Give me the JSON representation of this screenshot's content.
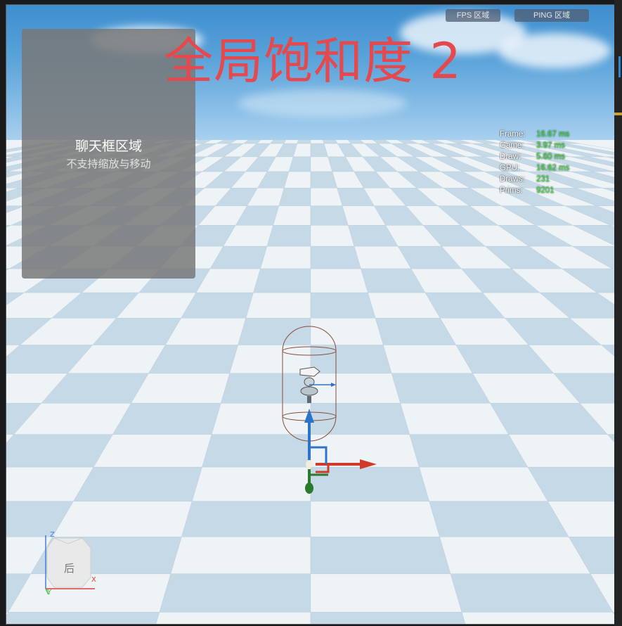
{
  "hud": {
    "fps_button": "FPS 区域",
    "ping_button": "PING 区域"
  },
  "title_overlay": "全局饱和度 2",
  "chat_panel": {
    "title": "聊天框区域",
    "subtitle": "不支持缩放与移动"
  },
  "stats": [
    {
      "label": "Frame:",
      "value": "16.67 ms"
    },
    {
      "label": "Game:",
      "value": "3.97 ms"
    },
    {
      "label": "Draw:",
      "value": "5.60 ms"
    },
    {
      "label": "GPU:",
      "value": "16.62 ms"
    },
    {
      "label": "Draws:",
      "value": "231"
    },
    {
      "label": "Prims:",
      "value": "9201"
    }
  ],
  "view_cube": {
    "face_label": "后",
    "x_axis": "X",
    "y_axis": "Y",
    "z_axis": "Z"
  },
  "colors": {
    "title": "#e5484d",
    "stat_value": "#38e53a",
    "gizmo_x": "#d0392b",
    "gizmo_y": "#2c7a2c",
    "gizmo_z": "#2d73c7"
  },
  "icons": {
    "gizmo": "transform-gizmo-icon",
    "view_cube": "view-cube-icon"
  }
}
